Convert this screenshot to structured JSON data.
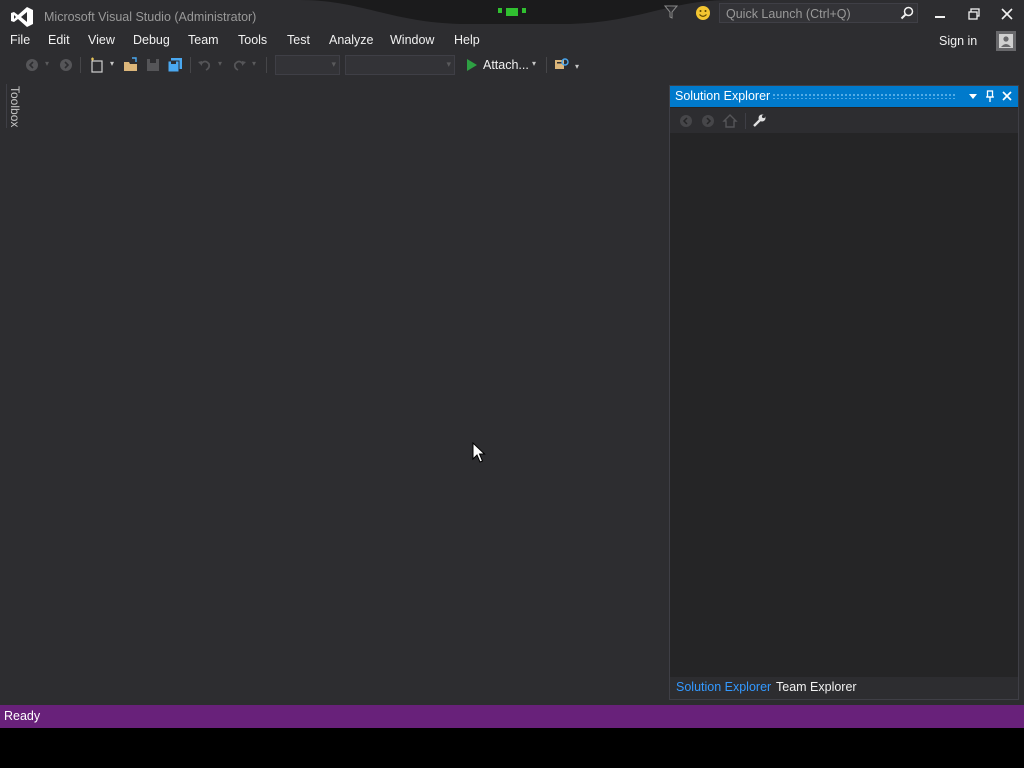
{
  "window": {
    "title": "Microsoft Visual Studio (Administrator)",
    "quick_launch_placeholder": "Quick Launch (Ctrl+Q)",
    "sign_in": "Sign in",
    "icons": [
      "vs-logo-icon",
      "filter-icon",
      "feedback-smiley-icon",
      "search-icon",
      "minimize-icon",
      "restore-icon",
      "close-icon",
      "account-icon"
    ]
  },
  "menu": {
    "items": [
      {
        "label": "File"
      },
      {
        "label": "Edit"
      },
      {
        "label": "View"
      },
      {
        "label": "Debug"
      },
      {
        "label": "Team"
      },
      {
        "label": "Tools"
      },
      {
        "label": "Test"
      },
      {
        "label": "Analyze"
      },
      {
        "label": "Window"
      },
      {
        "label": "Help"
      }
    ]
  },
  "toolbar": {
    "attach_label": "Attach...",
    "config_combo_value": "",
    "platform_combo_value": "",
    "icons": [
      "back-icon",
      "forward-icon",
      "new-project-icon",
      "open-file-icon",
      "save-icon",
      "save-all-icon",
      "undo-icon",
      "redo-icon",
      "start-icon",
      "find-in-files-icon"
    ]
  },
  "toolbox": {
    "label": "Toolbox"
  },
  "solution_explorer": {
    "title": "Solution Explorer",
    "tabs": [
      {
        "label": "Solution Explorer",
        "active": true
      },
      {
        "label": "Team Explorer",
        "active": false
      }
    ]
  },
  "status": {
    "text": "Ready"
  },
  "colors": {
    "background": "#2d2d30",
    "accent": "#007acc",
    "status_bar": "#68217a",
    "vs_logo": "#ffffff",
    "start_green": "#2ea043",
    "active_tab": "#3399ff"
  }
}
